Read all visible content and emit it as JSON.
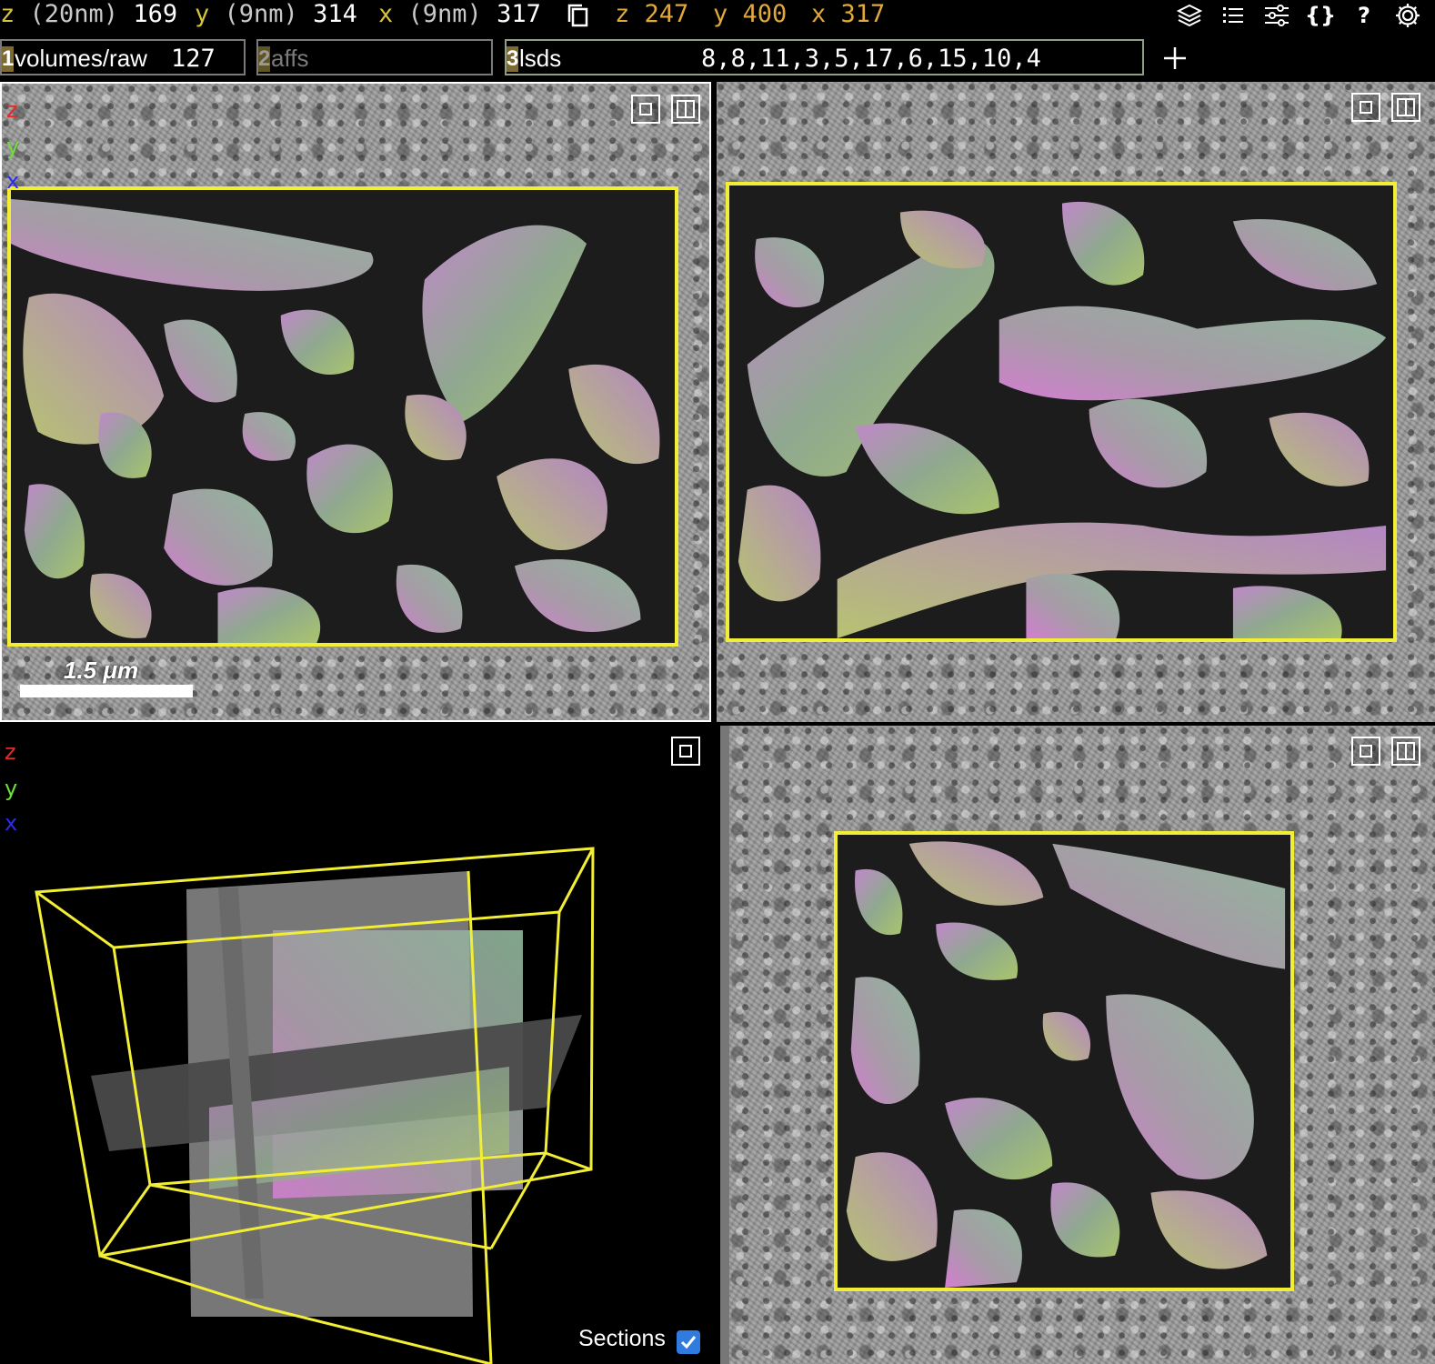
{
  "position": {
    "z_label": "z",
    "z_unit": "(20nm)",
    "z_value": "169",
    "y_label": "y",
    "y_unit": "(9nm)",
    "y_value": "314",
    "x_label": "x",
    "x_unit": "(9nm)",
    "x_value": "317"
  },
  "mouse_position": {
    "z_label": "z",
    "z_value": "247",
    "y_label": "y",
    "y_value": "400",
    "x_label": "x",
    "x_value": "317"
  },
  "toolbar": {
    "help_label": "?",
    "json_label": "{}"
  },
  "layers": [
    {
      "number": "1",
      "name": "volumes/raw",
      "value": "127"
    },
    {
      "number": "2",
      "name": "affs",
      "value": ""
    },
    {
      "number": "3",
      "name": "lsds",
      "value": "8,8,11,3,5,17,6,15,10,4"
    }
  ],
  "axes": {
    "z": "z",
    "y": "y",
    "x": "x"
  },
  "axis_colors": {
    "z": "#e02b2b",
    "y": "#6fe03a",
    "x": "#2c2ce8"
  },
  "scale_bar": {
    "label": "1.5 μm"
  },
  "view3d": {
    "sections_label": "Sections",
    "sections_checked": true
  },
  "colors": {
    "bounding_box": "#f2ee35",
    "accent": "#2f7be0"
  }
}
